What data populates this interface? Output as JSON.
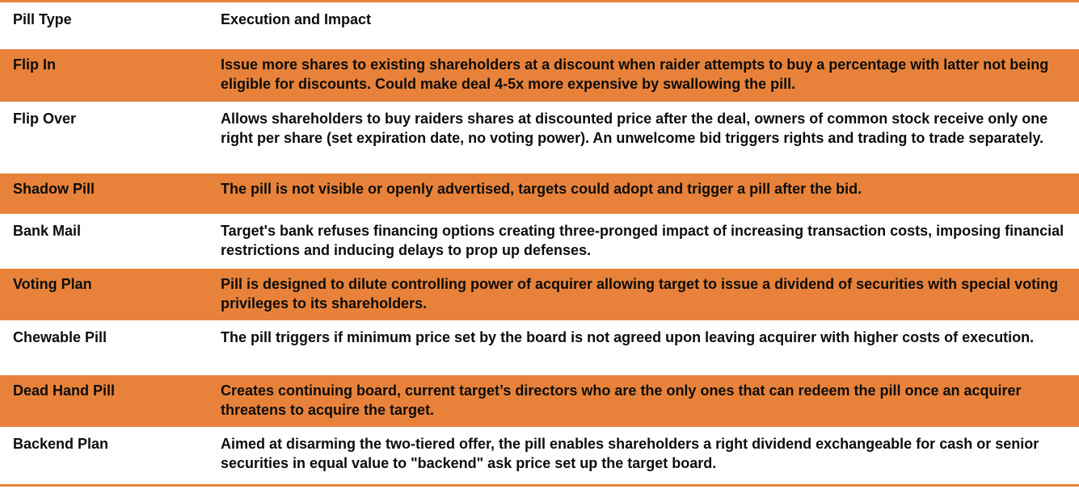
{
  "header": {
    "col1": "Pill Type",
    "col2": "Execution and Impact"
  },
  "rows": [
    {
      "type": "Flip In",
      "impact": "Issue more shares to existing shareholders at a discount when raider attempts to buy a percentage with latter not being eligible for discounts. Could make deal 4-5x more expensive by swallowing the pill."
    },
    {
      "type": "Flip Over",
      "impact": "Allows shareholders to buy raiders shares at discounted price after the deal, owners of common stock receive only one right per share (set expiration date, no voting power). An unwelcome bid triggers rights and trading to trade separately."
    },
    {
      "type": "Shadow Pill",
      "impact": "The pill is not visible or openly advertised, targets could adopt and trigger a pill after the bid."
    },
    {
      "type": "Bank Mail",
      "impact": "Target's bank refuses financing options creating three-pronged impact of increasing transaction costs, imposing financial restrictions and inducing delays to prop up defenses."
    },
    {
      "type": "Voting Plan",
      "impact": "Pill is designed to dilute controlling power of acquirer allowing target to issue a dividend of securities with special voting privileges to its shareholders."
    },
    {
      "type": "Chewable Pill",
      "impact": "The pill triggers if minimum price set by the board is not agreed upon leaving acquirer with higher costs of execution."
    },
    {
      "type": "Dead Hand Pill",
      "impact": "Creates continuing board, current target’s directors who are the only ones that can redeem the pill once an acquirer threatens to acquire the target."
    },
    {
      "type": "Backend Plan",
      "impact": "Aimed at disarming the two-tiered offer, the pill enables shareholders a right dividend exchangeable for cash or senior securities in equal value to \"backend\" ask price set up the target board."
    }
  ],
  "colors": {
    "accent": "#E8823A",
    "text": "#0d0d0d",
    "background": "#ffffff"
  }
}
